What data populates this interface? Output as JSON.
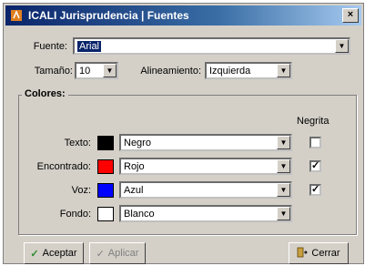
{
  "window": {
    "title": "ICALI Jurisprudencia | Fuentes",
    "close_label": "×"
  },
  "form": {
    "fuente_label": "Fuente:",
    "fuente_value": "Arial",
    "tamano_label": "Tamaño:",
    "tamano_value": "10",
    "alineamiento_label": "Alineamiento:",
    "alineamiento_value": "Izquierda"
  },
  "colores": {
    "title": "Colores:",
    "negrita_header": "Negrita",
    "rows": [
      {
        "label": "Texto:",
        "color_name": "Negro",
        "swatch": "#000000",
        "bold": false
      },
      {
        "label": "Encontrado:",
        "color_name": "Rojo",
        "swatch": "#ff0000",
        "bold": true
      },
      {
        "label": "Voz:",
        "color_name": "Azul",
        "swatch": "#0000ff",
        "bold": true
      },
      {
        "label": "Fondo:",
        "color_name": "Blanco",
        "swatch": "#ffffff",
        "bold": null
      }
    ]
  },
  "buttons": {
    "aceptar": "Aceptar",
    "aplicar": "Aplicar",
    "cerrar": "Cerrar"
  },
  "colors": {
    "titlebar_start": "#0a246a",
    "titlebar_end": "#a6caf0",
    "face": "#d4d0c8"
  }
}
